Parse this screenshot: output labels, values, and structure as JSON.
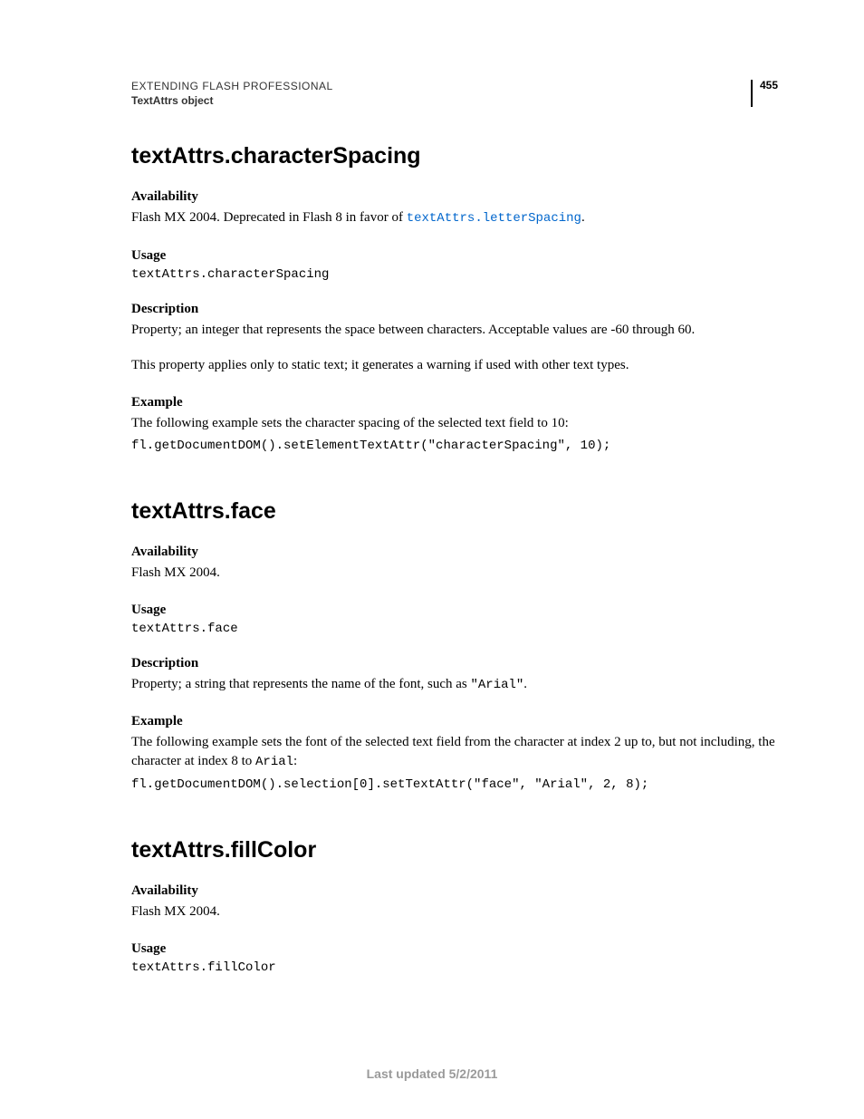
{
  "header": {
    "title": "EXTENDING FLASH PROFESSIONAL",
    "subtitle": "TextAttrs object",
    "pageNumber": "455"
  },
  "sections": [
    {
      "title": "textAttrs.characterSpacing",
      "availability": {
        "h": "Availability",
        "prefix": "Flash MX 2004. Deprecated in Flash 8 in favor of ",
        "link": "textAttrs.letterSpacing",
        "suffix": "."
      },
      "usage": {
        "h": "Usage",
        "code": "textAttrs.characterSpacing"
      },
      "description": {
        "h": "Description",
        "p1": "Property; an integer that represents the space between characters. Acceptable values are -60 through 60.",
        "p2": "This property applies only to static text; it generates a warning if used with other text types."
      },
      "example": {
        "h": "Example",
        "p": "The following example sets the character spacing of the selected text field to 10:",
        "code": "fl.getDocumentDOM().setElementTextAttr(\"characterSpacing\", 10);"
      }
    },
    {
      "title": "textAttrs.face",
      "availability": {
        "h": "Availability",
        "p": "Flash MX 2004."
      },
      "usage": {
        "h": "Usage",
        "code": "textAttrs.face"
      },
      "description": {
        "h": "Description",
        "prefix": "Property; a string that represents the name of the font, such as ",
        "code": "\"Arial\"",
        "suffix": "."
      },
      "example": {
        "h": "Example",
        "prefix": "The following example sets the font of the selected text field from the character at index 2 up to, but not including, the character at index 8 to ",
        "code_inline": "Arial",
        "suffix": ":",
        "code": "fl.getDocumentDOM().selection[0].setTextAttr(\"face\", \"Arial\", 2, 8);"
      }
    },
    {
      "title": "textAttrs.fillColor",
      "availability": {
        "h": "Availability",
        "p": "Flash MX 2004."
      },
      "usage": {
        "h": "Usage",
        "code": "textAttrs.fillColor"
      }
    }
  ],
  "footer": "Last updated 5/2/2011"
}
